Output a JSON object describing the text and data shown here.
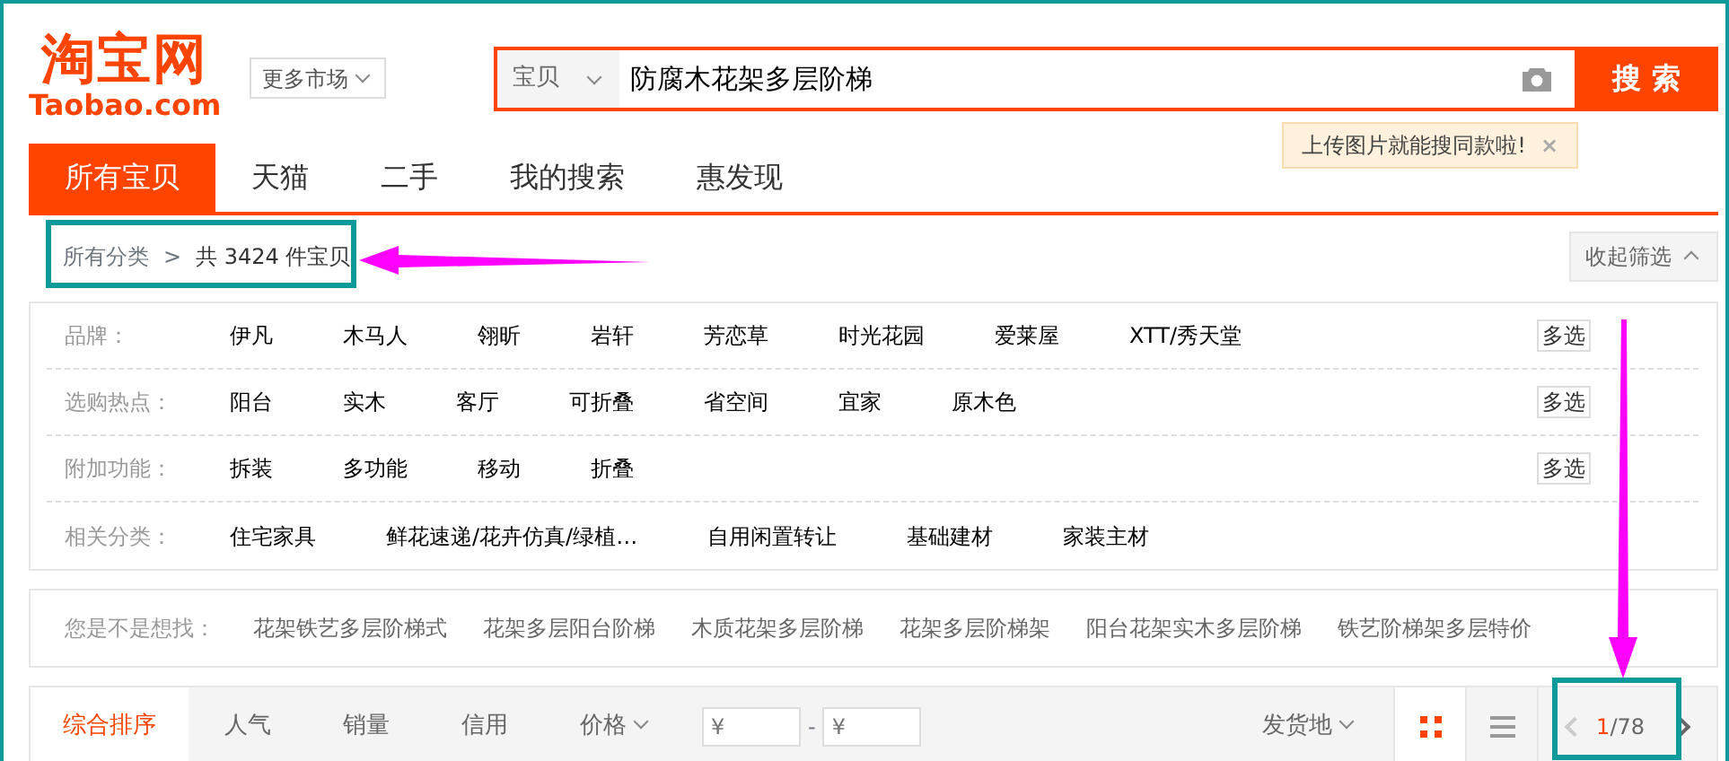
{
  "header": {
    "logo": {
      "title": "淘宝网",
      "subtitle": "Taobao.com"
    },
    "market_dropdown": "更多市场",
    "search": {
      "scope": "宝贝",
      "value": "防腐木花架多层阶梯",
      "button": "搜 索"
    },
    "tooltip": {
      "text": "上传图片就能搜同款啦!",
      "close": "×"
    }
  },
  "tabs": [
    {
      "label": "所有宝贝",
      "selected": true
    },
    {
      "label": "天猫",
      "selected": false
    },
    {
      "label": "二手",
      "selected": false
    },
    {
      "label": "我的搜索",
      "selected": false
    },
    {
      "label": "惠发现",
      "selected": false
    }
  ],
  "breadcrumb": {
    "root": "所有分类",
    "separator": ">",
    "count_text": "共 3424 件宝贝"
  },
  "collapse_button": "收起筛选",
  "filters": [
    {
      "label": "品牌：",
      "items": [
        "伊凡",
        "木马人",
        "翎昕",
        "岩轩",
        "芳恋草",
        "时光花园",
        "爱莱屋",
        "XTT/秀天堂"
      ],
      "multi_button": "多选"
    },
    {
      "label": "选购热点：",
      "items": [
        "阳台",
        "实木",
        "客厅",
        "可折叠",
        "省空间",
        "宜家",
        "原木色"
      ],
      "multi_button": "多选"
    },
    {
      "label": "附加功能：",
      "items": [
        "拆装",
        "多功能",
        "移动",
        "折叠"
      ],
      "multi_button": "多选"
    },
    {
      "label": "相关分类：",
      "items": [
        "住宅家具",
        "鲜花速递/花卉仿真/绿植…",
        "自用闲置转让",
        "基础建材",
        "家装主材"
      ]
    }
  ],
  "suggestions": {
    "label": "您是不是想找：",
    "items": [
      "花架铁艺多层阶梯式",
      "花架多层阳台阶梯",
      "木质花架多层阶梯",
      "花架多层阶梯架",
      "阳台花架实木多层阶梯",
      "铁艺阶梯架多层特价"
    ]
  },
  "sort_bar": {
    "options": [
      {
        "label": "综合排序",
        "selected": true
      },
      {
        "label": "人气",
        "selected": false
      },
      {
        "label": "销量",
        "selected": false
      },
      {
        "label": "信用",
        "selected": false
      },
      {
        "label": "价格",
        "selected": false
      }
    ],
    "price_min_placeholder": "¥",
    "price_separator": "-",
    "price_max_placeholder": "¥",
    "ship_from": "发货地",
    "views": [
      {
        "kind": "grid",
        "selected": true
      },
      {
        "kind": "list",
        "selected": false
      }
    ],
    "pager": {
      "current": "1",
      "total": "/78"
    }
  }
}
